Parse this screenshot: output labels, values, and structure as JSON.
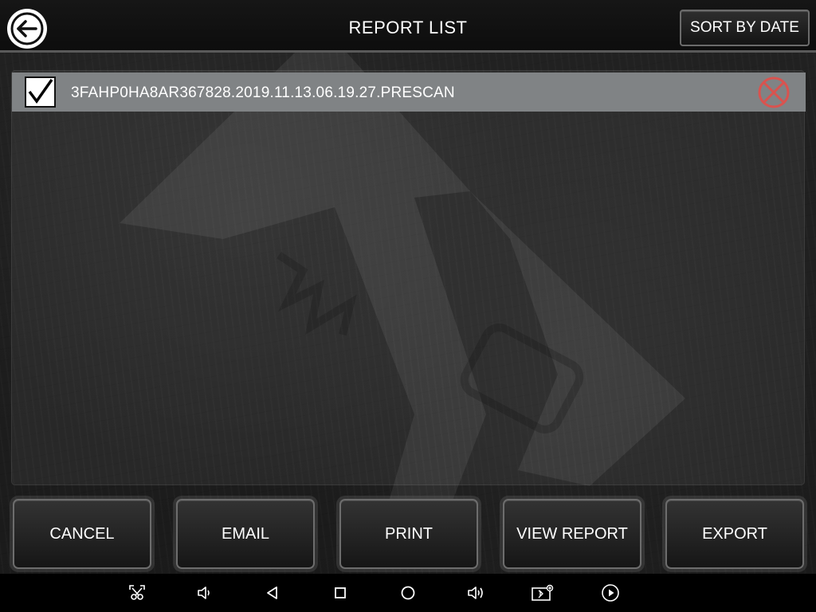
{
  "header": {
    "title": "REPORT LIST",
    "sort_label": "SORT BY DATE"
  },
  "reports": [
    {
      "name": "3FAHP0HA8AR367828.2019.11.13.06.19.27.PRESCAN",
      "checked": true
    }
  ],
  "actions": {
    "cancel": "CANCEL",
    "email": "EMAIL",
    "print": "PRINT",
    "view_report": "VIEW REPORT",
    "export": "EXPORT"
  },
  "icons": {
    "back": "back-arrow-icon",
    "delete": "delete-circle-x-icon",
    "nav": [
      "screenshot-icon",
      "volume-down-icon",
      "back-triangle-icon",
      "recents-square-icon",
      "home-circle-icon",
      "volume-up-icon",
      "bluetooth-settings-icon",
      "play-icon"
    ]
  },
  "colors": {
    "row_selected": "#808385",
    "delete_red": "#d9534f",
    "button_border": "#6d6d6d"
  }
}
